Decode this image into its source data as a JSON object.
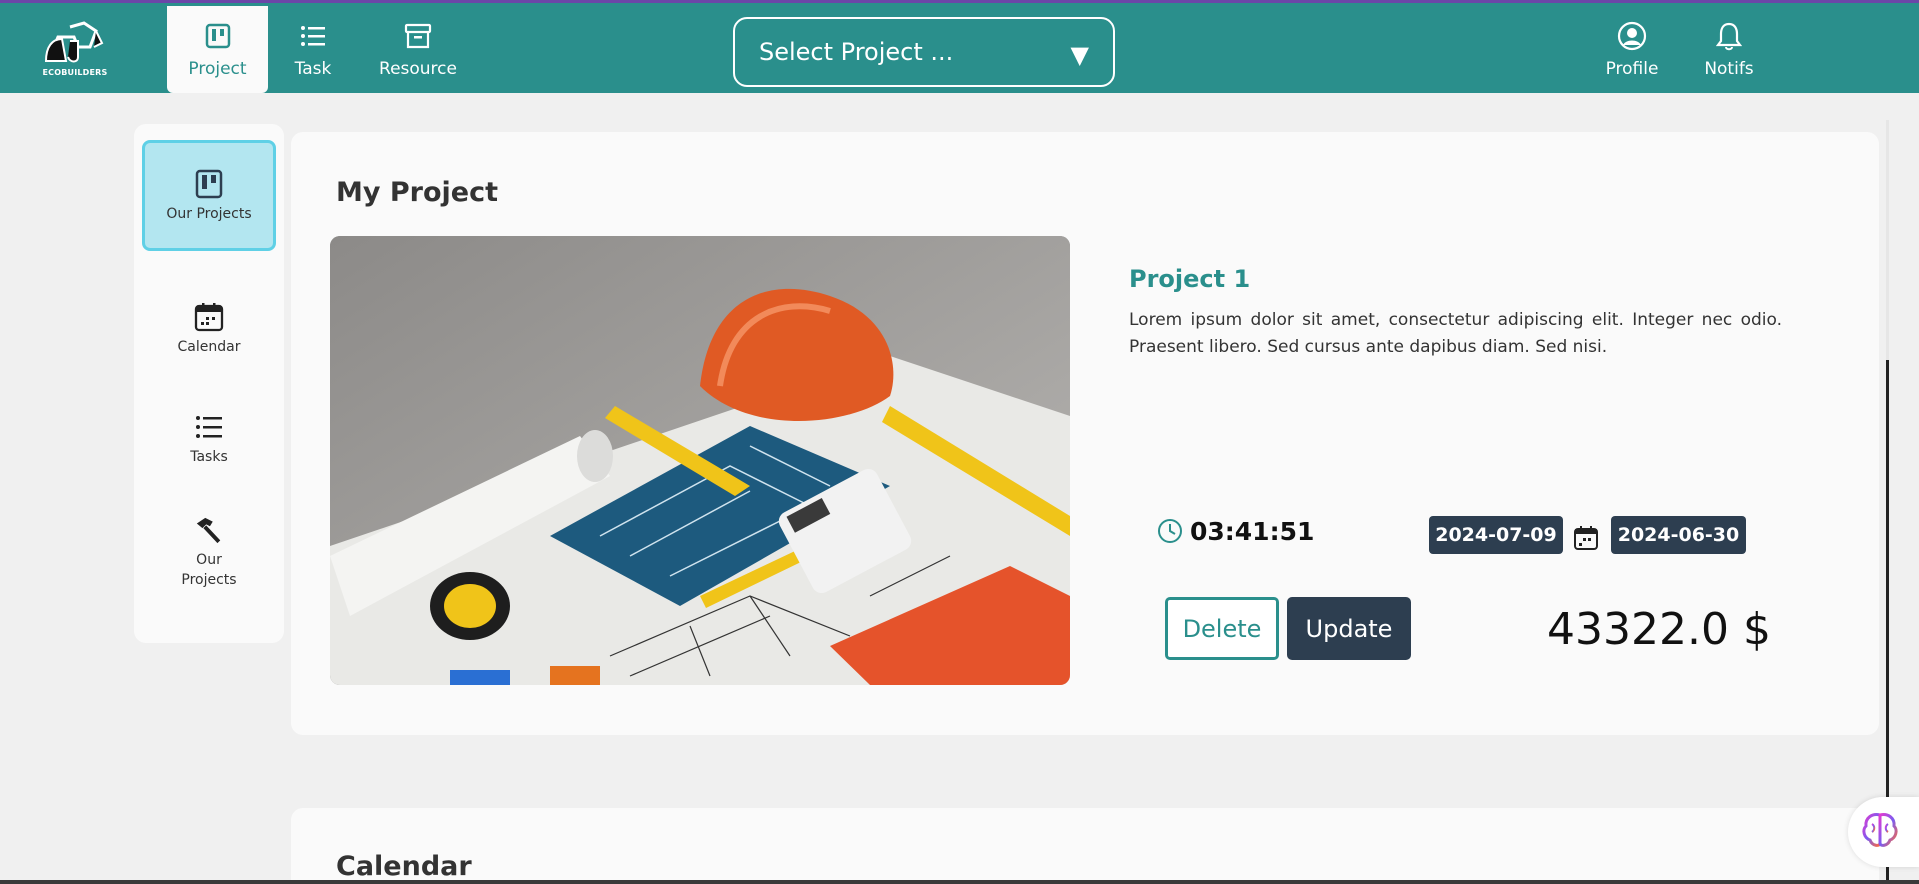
{
  "brand": {
    "name": "ECOBUILDERS"
  },
  "topnav": {
    "items": [
      {
        "label": "Project",
        "icon": "kanban-icon",
        "active": true
      },
      {
        "label": "Task",
        "icon": "list-icon",
        "active": false
      },
      {
        "label": "Resource",
        "icon": "archive-icon",
        "active": false
      }
    ],
    "select_project": "Select Project ...",
    "profile_label": "Profile",
    "notifs_label": "Notifs"
  },
  "sidebar": {
    "items": [
      {
        "label": "Our Projects",
        "icon": "kanban-icon",
        "active": true
      },
      {
        "label": "Calendar",
        "icon": "calendar-icon",
        "active": false
      },
      {
        "label": "Tasks",
        "icon": "list-icon",
        "active": false
      },
      {
        "label": "Our Projects",
        "icon": "hammer-icon",
        "active": false
      }
    ]
  },
  "main": {
    "title": "My Project",
    "project": {
      "name": "Project 1",
      "description": "Lorem ipsum dolor sit amet, consectetur adipiscing elit. Integer nec odio. Praesent libero. Sed cursus ante dapibus diam. Sed nisi.",
      "timer": "03:41:51",
      "start_date": "2024-07-09",
      "end_date": "2024-06-30",
      "delete_label": "Delete",
      "update_label": "Update",
      "price": "43322.0 $"
    },
    "calendar_title": "Calendar"
  },
  "colors": {
    "primary": "#2a8f8c",
    "dark": "#2d3e50",
    "sidebar_active": "#b3e6f0",
    "accent_top": "#6b46a8"
  }
}
